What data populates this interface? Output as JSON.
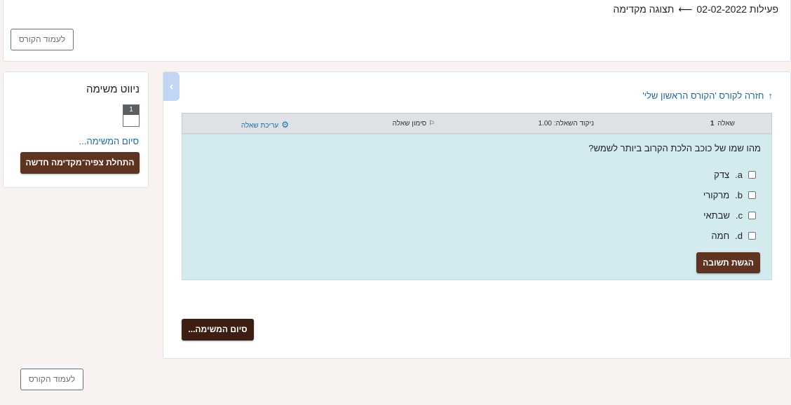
{
  "header": {
    "breadcrumb_activity": "פעילות 02-02-2022",
    "breadcrumb_arrow": "⟵",
    "breadcrumb_current": "תצוגה מקדימה",
    "course_button": "לעמוד הקורס"
  },
  "nav": {
    "title": "ניווט משימה",
    "question_number": "1",
    "finish_link": "סיום המשימה...",
    "new_preview_button": "התחלת צפיה־מקדימה חדשה"
  },
  "main": {
    "back_link": "חזרה לקורס 'הקורס הראשון שלי'",
    "question_info": {
      "label": "שאלה",
      "number": "1",
      "grade": "ניקוד השאלה: 1.00",
      "flag": "סימון שאלה",
      "edit": "עריכת שאלה"
    },
    "question_text": "מהו שמו של כוכב הלכת הקרוב ביותר לשמש?",
    "options": [
      {
        "letter": "a.",
        "text": "צדק"
      },
      {
        "letter": "b.",
        "text": "מרקורי"
      },
      {
        "letter": "c.",
        "text": "שבתאי"
      },
      {
        "letter": "d.",
        "text": "חמה"
      }
    ],
    "submit_button": "הגשת תשובה",
    "finish_button": "סיום המשימה..."
  },
  "footer": {
    "course_button": "לעמוד הקורס"
  },
  "icons": {
    "drawer_toggle": "chevron-right-icon",
    "back": "arrow-up-icon",
    "flag": "flag-icon",
    "edit": "gear-icon"
  },
  "colors": {
    "brand_button": "#5e3320",
    "finish_button": "#3c1e12",
    "question_bg": "#d3ebef",
    "link": "#1f6aa5"
  }
}
